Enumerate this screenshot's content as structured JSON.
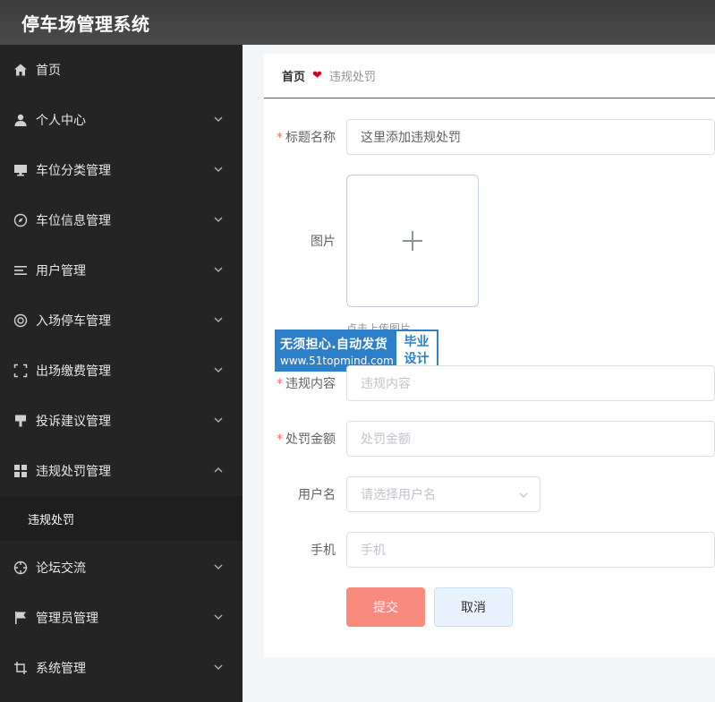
{
  "app": {
    "title": "停车场管理系统"
  },
  "sidebar": {
    "items": [
      {
        "label": "首页",
        "icon": "home-icon"
      },
      {
        "label": "个人中心",
        "icon": "user-icon"
      },
      {
        "label": "车位分类管理",
        "icon": "monitor-icon"
      },
      {
        "label": "车位信息管理",
        "icon": "compass-icon"
      },
      {
        "label": "用户管理",
        "icon": "list-icon"
      },
      {
        "label": "入场停车管理",
        "icon": "lifebuoy-icon"
      },
      {
        "label": "出场缴费管理",
        "icon": "fullscreen-icon"
      },
      {
        "label": "投诉建议管理",
        "icon": "stamp-icon"
      },
      {
        "label": "违规处罚管理",
        "icon": "grid-icon"
      },
      {
        "label": "论坛交流",
        "icon": "target-icon"
      },
      {
        "label": "管理员管理",
        "icon": "flag-icon"
      },
      {
        "label": "系统管理",
        "icon": "crop-icon"
      }
    ],
    "submenu": {
      "label": "违规处罚"
    }
  },
  "breadcrumb": {
    "home": "首页",
    "current": "违规处罚"
  },
  "form": {
    "title_label": "标题名称",
    "title_value": "这里添加违规处罚",
    "image_label": "图片",
    "upload_tip": "点击上传图片",
    "content_label": "违规内容",
    "content_placeholder": "违规内容",
    "amount_label": "处罚金额",
    "amount_placeholder": "处罚金额",
    "username_label": "用户名",
    "username_placeholder": "请选择用户名",
    "phone_label": "手机",
    "phone_placeholder": "手机",
    "submit_label": "提交",
    "cancel_label": "取消"
  },
  "watermark": {
    "line1": "无须担心.自动发货",
    "line2": "www.51topmind.com",
    "badge_line1": "毕业",
    "badge_line2": "设计"
  }
}
